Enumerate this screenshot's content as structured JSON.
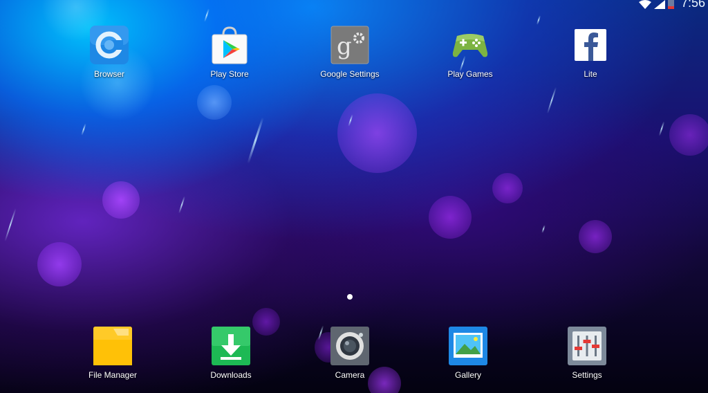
{
  "status_bar": {
    "clock": "7:56",
    "icons": [
      "wifi-icon",
      "cell-signal-icon",
      "battery-low-icon"
    ],
    "battery_color": "#e53935"
  },
  "home": {
    "top_row": [
      {
        "label": "Browser",
        "icon": "browser-icon"
      },
      {
        "label": "Play Store",
        "icon": "play-store-icon"
      },
      {
        "label": "Google Settings",
        "icon": "google-settings-icon"
      },
      {
        "label": "Play Games",
        "icon": "play-games-icon"
      },
      {
        "label": "Lite",
        "icon": "facebook-lite-icon"
      }
    ],
    "page_indicator": {
      "current": 1,
      "total": 1
    }
  },
  "dock": [
    {
      "label": "File Manager",
      "icon": "folder-icon"
    },
    {
      "label": "Downloads",
      "icon": "download-icon"
    },
    {
      "label": "Camera",
      "icon": "camera-icon"
    },
    {
      "label": "Gallery",
      "icon": "gallery-icon"
    },
    {
      "label": "Settings",
      "icon": "settings-sliders-icon"
    }
  ],
  "colors": {
    "wallpaper_top": "#0a78ff",
    "wallpaper_mid": "#5a20c8",
    "wallpaper_bottom": "#030210",
    "bokeh": "#8a3cf0"
  }
}
